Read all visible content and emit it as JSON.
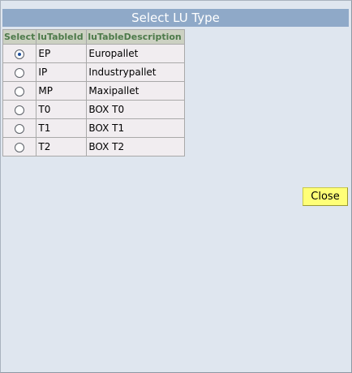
{
  "dialog": {
    "title": "Select LU Type",
    "close_label": "Close"
  },
  "table": {
    "headers": [
      "Select",
      "luTableId",
      "luTableDescription"
    ],
    "rows": [
      {
        "selected": true,
        "id": "EP",
        "description": "Europallet"
      },
      {
        "selected": false,
        "id": "IP",
        "description": "Industrypallet"
      },
      {
        "selected": false,
        "id": "MP",
        "description": "Maxipallet"
      },
      {
        "selected": false,
        "id": "T0",
        "description": "BOX T0"
      },
      {
        "selected": false,
        "id": "T1",
        "description": "BOX T1"
      },
      {
        "selected": false,
        "id": "T2",
        "description": "BOX T2"
      }
    ]
  },
  "colors": {
    "page_background": "#dfe6ef",
    "title_bar": "#8fa9c8",
    "header_background": "#ccd1c2",
    "header_text": "#4d7a4a",
    "close_button": "#ffff77"
  }
}
